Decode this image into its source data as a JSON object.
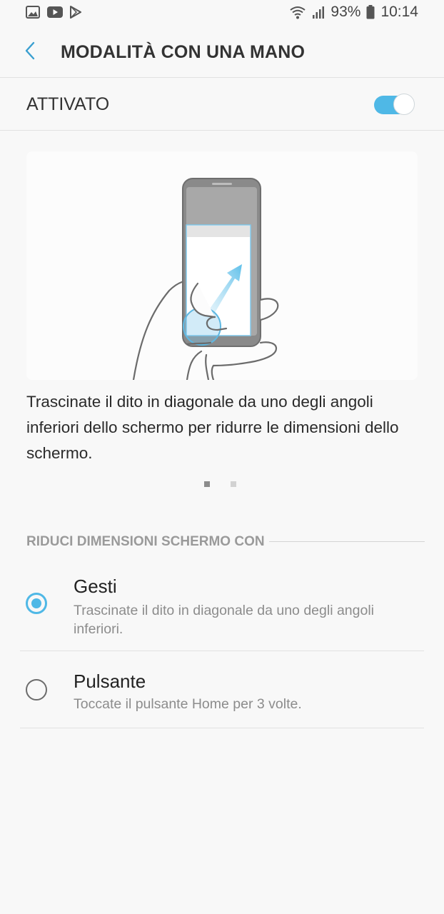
{
  "status_bar": {
    "icons_left": [
      "gallery-icon",
      "youtube-icon",
      "play-store-icon"
    ],
    "icons_right": [
      "wifi-icon",
      "signal-icon",
      "battery-icon"
    ],
    "battery": "93%",
    "time": "10:14"
  },
  "header": {
    "title": "MODALITÀ CON UNA MANO"
  },
  "master_switch": {
    "label": "ATTIVATO",
    "on": true
  },
  "tutorial": {
    "description": "Trascinate il dito in diagonale da uno degli angoli inferiori dello schermo per ridurre le dimensioni dello schermo.",
    "page_count": 2,
    "current_page": 1
  },
  "section": {
    "title": "RIDUCI DIMENSIONI SCHERMO CON"
  },
  "options": [
    {
      "title": "Gesti",
      "subtitle": "Trascinate il dito in diagonale da uno degli angoli inferiori.",
      "selected": true
    },
    {
      "title": "Pulsante",
      "subtitle": "Toccate il pulsante Home per 3 volte.",
      "selected": false
    }
  ],
  "colors": {
    "accent": "#4fb8e6",
    "background": "#f8f8f8",
    "secondary_text": "#8c8c8c"
  }
}
